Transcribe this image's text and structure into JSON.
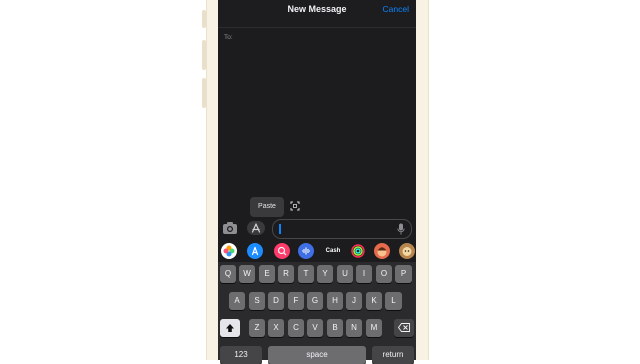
{
  "nav": {
    "title": "New Message",
    "cancel": "Cancel"
  },
  "to_label": "To:",
  "context_menu": {
    "paste": "Paste"
  },
  "apps": [
    {
      "name": "photos-app",
      "color": "#ffffff",
      "text": ""
    },
    {
      "name": "app-store-app",
      "color": "#1c8cff",
      "text": "A"
    },
    {
      "name": "search-images-app",
      "color": "#ff3b6b",
      "text": ""
    },
    {
      "name": "audio-app",
      "color": "#3f6fe6",
      "text": ""
    },
    {
      "name": "apple-cash-app",
      "color": "#1c1c1e",
      "text": "Cash"
    },
    {
      "name": "fitness-app",
      "color": "#1c1c1e",
      "text": ""
    },
    {
      "name": "memoji-app",
      "color": "#f0b27a",
      "text": ""
    },
    {
      "name": "animoji-app",
      "color": "#c9915c",
      "text": ""
    }
  ],
  "keyboard": {
    "row1": [
      "Q",
      "W",
      "E",
      "R",
      "T",
      "Y",
      "U",
      "I",
      "O",
      "P"
    ],
    "row2": [
      "A",
      "S",
      "D",
      "F",
      "G",
      "H",
      "J",
      "K",
      "L"
    ],
    "row3": [
      "Z",
      "X",
      "C",
      "V",
      "B",
      "N",
      "M"
    ],
    "numbers": "123",
    "space": "space",
    "return": "return"
  },
  "colors": {
    "accent": "#0a84ff",
    "background": "#1c1c1e"
  }
}
